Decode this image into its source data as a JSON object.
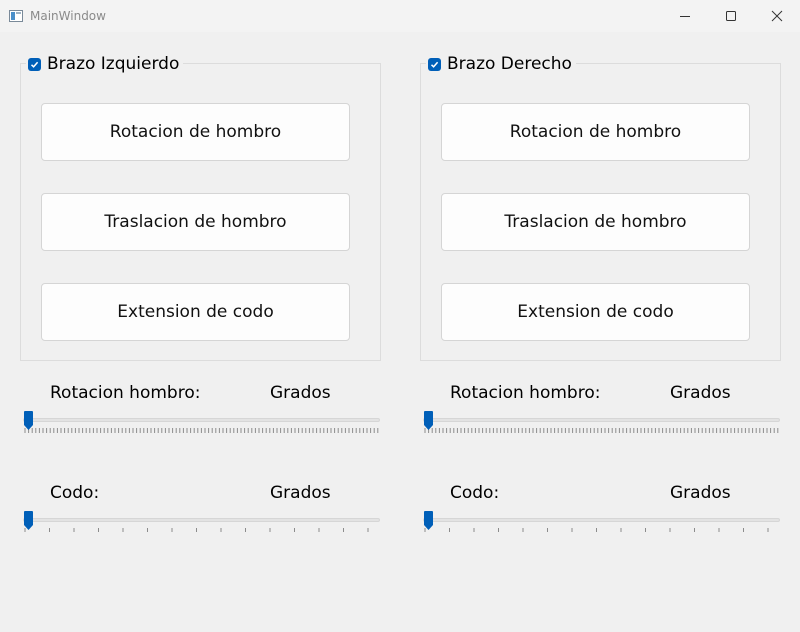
{
  "window": {
    "title": "MainWindow"
  },
  "left": {
    "group_title": "Brazo Izquierdo",
    "checked": true,
    "buttons": [
      "Rotacion de hombro",
      "Traslacion de hombro",
      "Extension de codo"
    ],
    "rot_label": "Rotacion hombro:",
    "rot_unit": "Grados",
    "rot_slider": {
      "value": 0
    },
    "elbow_label": "Codo:",
    "elbow_unit": "Grados",
    "elbow_slider": {
      "value": 0
    }
  },
  "right": {
    "group_title": "Brazo Derecho",
    "checked": true,
    "buttons": [
      "Rotacion de hombro",
      "Traslacion de hombro",
      "Extension de codo"
    ],
    "rot_label": "Rotacion hombro:",
    "rot_unit": "Grados",
    "rot_slider": {
      "value": 0
    },
    "elbow_label": "Codo:",
    "elbow_unit": "Grados",
    "elbow_slider": {
      "value": 0
    }
  },
  "colors": {
    "accent": "#005fb8",
    "background": "#f0f0f0"
  }
}
